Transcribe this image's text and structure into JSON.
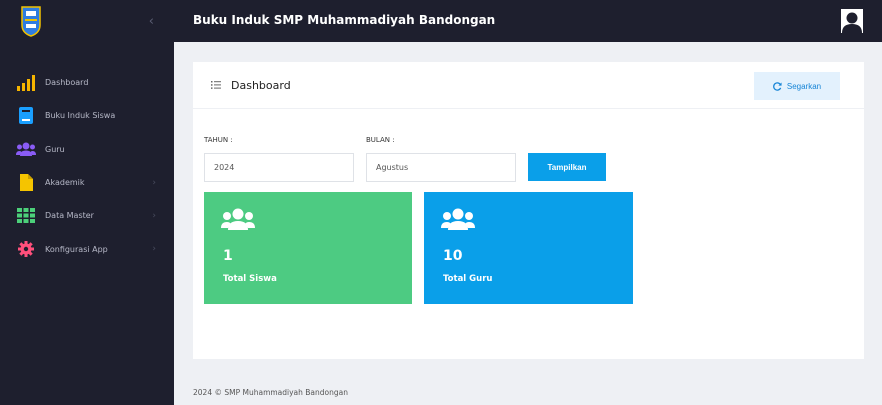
{
  "app": {
    "title": "Buku Induk SMP Muhammadiyah Bandongan"
  },
  "sidebar": {
    "collapse_glyph": "‹",
    "items": [
      {
        "label": "Dashboard",
        "icon": "signal-bars-icon",
        "color": "#f5b400",
        "has_submenu": false
      },
      {
        "label": "Buku Induk Siswa",
        "icon": "book-icon",
        "color": "#1a9fff",
        "has_submenu": false
      },
      {
        "label": "Guru",
        "icon": "users-icon",
        "color": "#8a5cf6",
        "has_submenu": false
      },
      {
        "label": "Akademik",
        "icon": "file-icon",
        "color": "#f5c400",
        "has_submenu": true
      },
      {
        "label": "Data Master",
        "icon": "grid-icon",
        "color": "#4cd07a",
        "has_submenu": true
      },
      {
        "label": "Konfigurasi App",
        "icon": "gear-icon",
        "color": "#ff4f7b",
        "has_submenu": true
      }
    ]
  },
  "main": {
    "card_title": "Dashboard",
    "refresh_label": "Segarkan",
    "filter": {
      "year_label": "TAHUN :",
      "year_value": "2024",
      "month_label": "BULAN :",
      "month_value": "Agustus",
      "submit_label": "Tampilkan"
    },
    "stats": [
      {
        "value": "1",
        "caption": "Total Siswa",
        "color": "#4dcb82"
      },
      {
        "value": "10",
        "caption": "Total Guru",
        "color": "#0a9fe9"
      }
    ]
  },
  "footer": {
    "text": "2024 © SMP Muhammadiyah Bandongan"
  }
}
